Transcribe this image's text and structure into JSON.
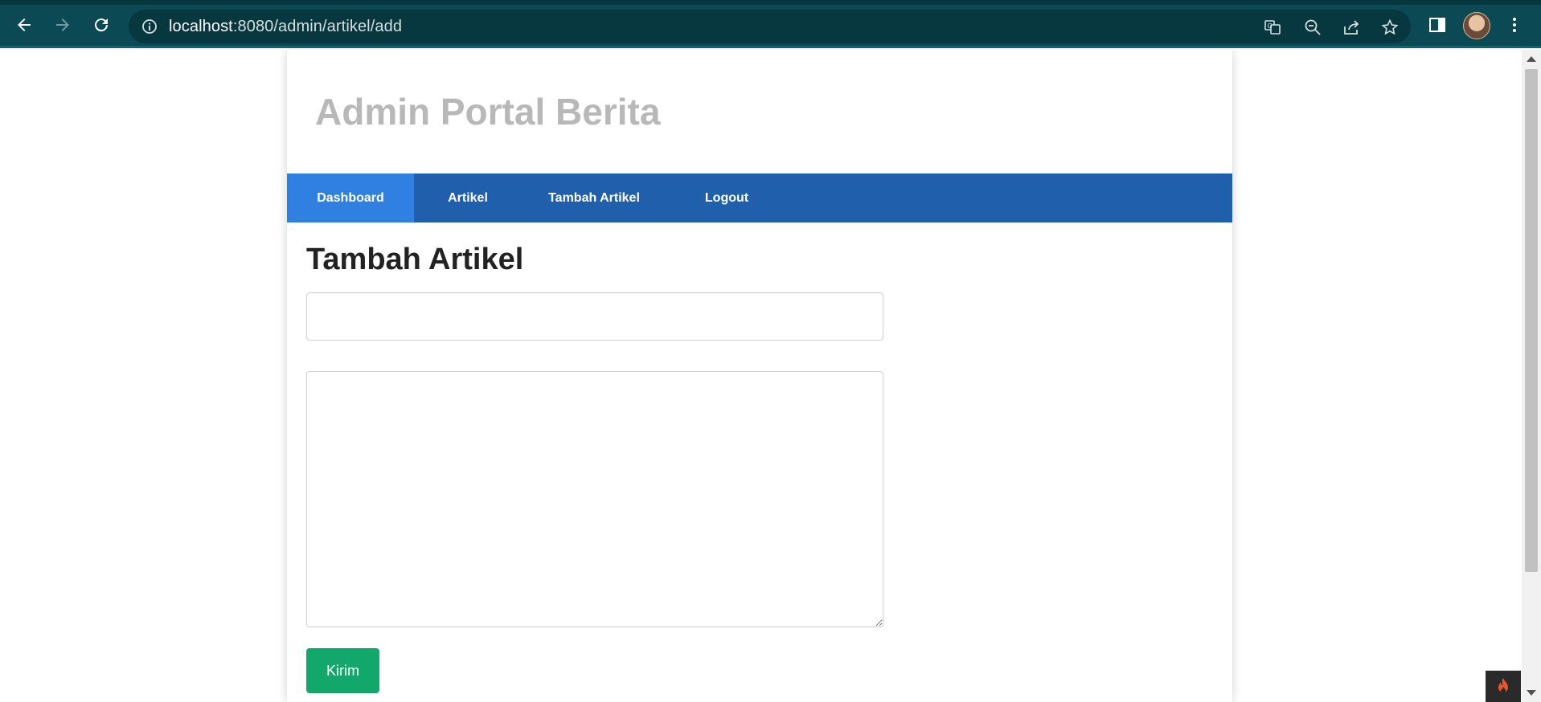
{
  "browser": {
    "url_host": "localhost",
    "url_rest": ":8080/admin/artikel/add",
    "colors": {
      "chrome": "#0b4a54",
      "omnibox": "#073840"
    }
  },
  "page": {
    "site_title": "Admin Portal Berita",
    "nav": [
      {
        "label": "Dashboard",
        "active": true
      },
      {
        "label": "Artikel",
        "active": false
      },
      {
        "label": "Tambah Artikel",
        "active": false
      },
      {
        "label": "Logout",
        "active": false
      }
    ],
    "form": {
      "heading": "Tambah Artikel",
      "title_value": "",
      "content_value": "",
      "submit_label": "Kirim"
    },
    "colors": {
      "nav_bg": "#1f5fac",
      "nav_active": "#2f80e0",
      "submit": "#13a86b",
      "title": "#b8b8b8"
    }
  }
}
